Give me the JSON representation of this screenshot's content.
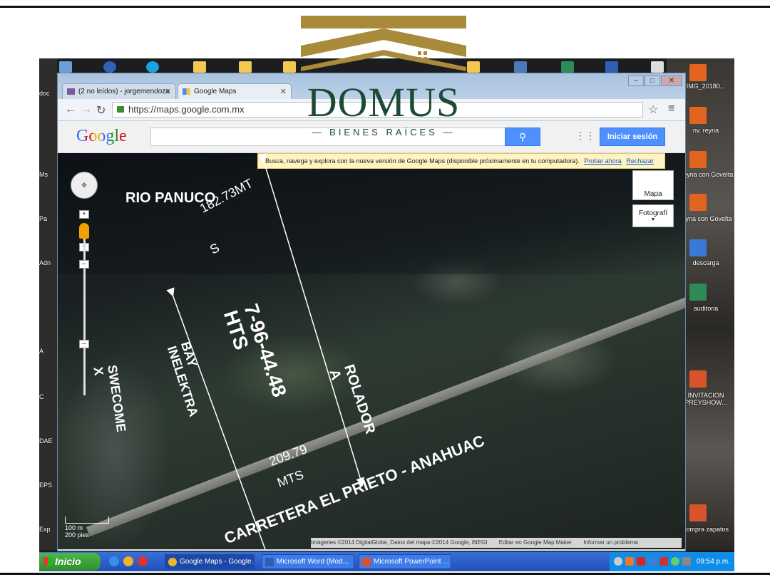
{
  "brand": {
    "name": "DOMUS",
    "subtitle": "— BIENES RAÍCES —",
    "gold": "#a98a3a",
    "green": "#1d4a35"
  },
  "desktop": {
    "right_icons": [
      {
        "label": "IMG_20180...",
        "icon": "image-file-icon"
      },
      {
        "label": "nv. reyna",
        "icon": "image-file-icon"
      },
      {
        "label": "Reyna con Govelta",
        "icon": "image-file-icon"
      },
      {
        "label": "reyna con Govelta",
        "icon": "image-file-icon"
      },
      {
        "label": "descarga",
        "icon": "image-file-icon"
      },
      {
        "label": "auditoria",
        "icon": "excel-file-icon"
      },
      {
        "label": "INVITACION PREYSHOW...",
        "icon": "powerpoint-file-icon"
      },
      {
        "label": "compra zapatos",
        "icon": "powerpoint-file-icon"
      }
    ],
    "left_labels": [
      "doc",
      "Ms",
      "Pa",
      "Adn",
      "A",
      "C",
      "DAE",
      "EPS",
      "Exp"
    ]
  },
  "browser": {
    "tabs": [
      {
        "label": "(2 no leídos) - jorgemendoza",
        "icon": "mail-icon"
      },
      {
        "label": "Google Maps",
        "icon": "google-maps-icon"
      }
    ],
    "url": "https://maps.google.com.mx",
    "google_logo": "Google",
    "search_placeholder": "",
    "signin_label": "Iniciar sesión",
    "notice_text": "Busca, navega y explora con la nueva versión de Google Maps (disponible próximamente en tu computadora).",
    "notice_try": "Probar ahora",
    "notice_dismiss": "Rechazar",
    "map_type_label": "Mapa",
    "satellite_label": "Fotografí",
    "scale_metric": "100 m",
    "scale_imperial": "200 pies",
    "attribution": "Imágenes ©2014 DigitalGlobe, Datos del mapa ©2014 Google, INEGI",
    "map_maker_link": "Editar en Google Map Maker",
    "report_link": "Informar un problema"
  },
  "map_annotations": {
    "river": "RIO PANUCO",
    "top_distance_1": "182.73MT",
    "top_distance_2": "S",
    "area_1": "7-96-44.48",
    "area_2": "HTS",
    "left_owner_1": "BAY",
    "left_owner_2": "INELEKTRA",
    "far_left_1": "SWECOME",
    "far_left_2": "X",
    "right_owner_1": "ROLADOR",
    "right_owner_2": "A",
    "bottom_distance_1": "209.79",
    "bottom_distance_2": "MTS",
    "road": "CARRETERA EL PRIETO - ANAHUAC"
  },
  "taskbar": {
    "start_label": "Inicio",
    "tasks": [
      {
        "label": "Google Maps - Google...",
        "icon": "chrome-icon"
      },
      {
        "label": "Microsoft Word (Mod...",
        "icon": "word-icon"
      },
      {
        "label": "Microsoft PowerPoint ...",
        "icon": "powerpoint-icon"
      }
    ],
    "clock": "09:54 p.m."
  }
}
